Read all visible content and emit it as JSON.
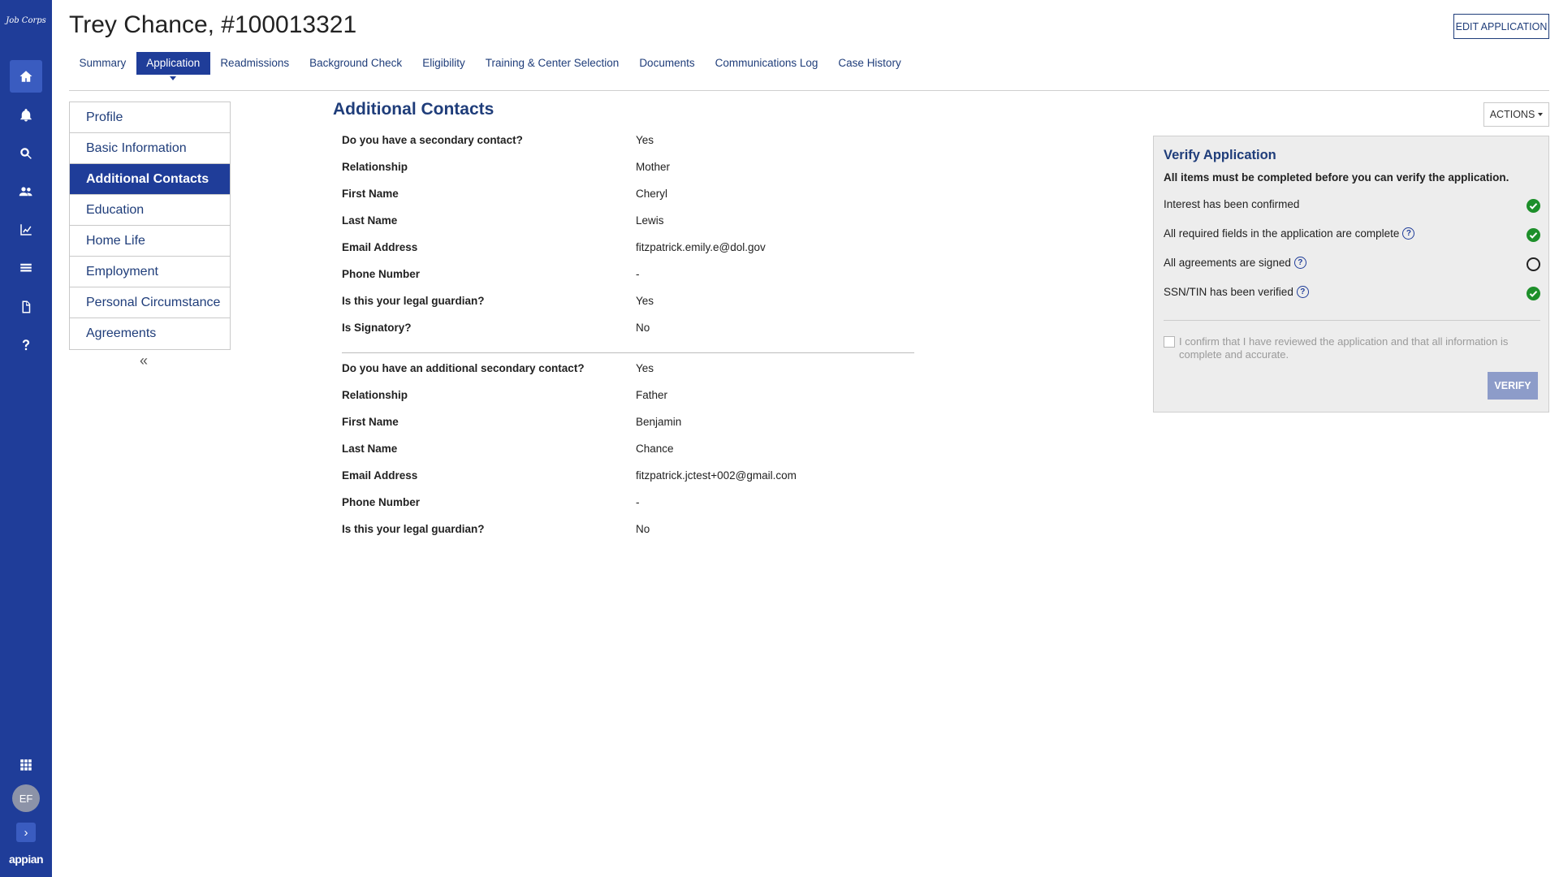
{
  "app": {
    "brand": "appian",
    "logo_text": "Job Corps",
    "user_initials": "EF"
  },
  "rail": {
    "icons": [
      "home-icon",
      "bell-icon",
      "search-icon",
      "users-icon",
      "chart-icon",
      "list-icon",
      "document-icon",
      "help-icon",
      "apps-grid-icon",
      "expand-icon"
    ],
    "expand_glyph": "›"
  },
  "header": {
    "title": "Trey Chance, #100013321",
    "edit_button": "EDIT APPLICATION"
  },
  "tabs": [
    {
      "label": "Summary",
      "active": false
    },
    {
      "label": "Application",
      "active": true
    },
    {
      "label": "Readmissions",
      "active": false
    },
    {
      "label": "Background Check",
      "active": false
    },
    {
      "label": "Eligibility",
      "active": false
    },
    {
      "label": "Training & Center Selection",
      "active": false
    },
    {
      "label": "Documents",
      "active": false
    },
    {
      "label": "Communications Log",
      "active": false
    },
    {
      "label": "Case History",
      "active": false
    }
  ],
  "side_menu": {
    "items": [
      {
        "label": "Profile",
        "active": false
      },
      {
        "label": "Basic Information",
        "active": false
      },
      {
        "label": "Additional Contacts",
        "active": true
      },
      {
        "label": "Education",
        "active": false
      },
      {
        "label": "Home Life",
        "active": false
      },
      {
        "label": "Employment",
        "active": false
      },
      {
        "label": "Personal Circumstance",
        "active": false
      },
      {
        "label": "Agreements",
        "active": false
      }
    ],
    "collapse_glyph": "«"
  },
  "main": {
    "section_title": "Additional Contacts",
    "contact1": [
      {
        "label": "Do you have a secondary contact?",
        "value": "Yes"
      },
      {
        "label": "Relationship",
        "value": "Mother"
      },
      {
        "label": "First Name",
        "value": "Cheryl"
      },
      {
        "label": "Last Name",
        "value": "Lewis"
      },
      {
        "label": "Email Address",
        "value": "fitzpatrick.emily.e@dol.gov"
      },
      {
        "label": "Phone Number",
        "value": "-"
      },
      {
        "label": "Is this your legal guardian?",
        "value": "Yes"
      },
      {
        "label": "Is Signatory?",
        "value": "No"
      }
    ],
    "contact2": [
      {
        "label": "Do you have an additional secondary contact?",
        "value": "Yes"
      },
      {
        "label": "Relationship",
        "value": "Father"
      },
      {
        "label": "First Name",
        "value": "Benjamin"
      },
      {
        "label": "Last Name",
        "value": "Chance"
      },
      {
        "label": "Email Address",
        "value": "fitzpatrick.jctest+002@gmail.com"
      },
      {
        "label": "Phone Number",
        "value": "-"
      },
      {
        "label": "Is this your legal guardian?",
        "value": "No"
      }
    ]
  },
  "actions": {
    "label": "ACTIONS"
  },
  "verify": {
    "title": "Verify Application",
    "instruction": "All items must be completed before you can verify the application.",
    "items": [
      {
        "label": "Interest has been confirmed",
        "has_help": false,
        "complete": true
      },
      {
        "label": "All required fields in the application are complete",
        "has_help": true,
        "complete": true
      },
      {
        "label": "All agreements are signed",
        "has_help": true,
        "complete": false
      },
      {
        "label": "SSN/TIN has been verified",
        "has_help": true,
        "complete": true
      }
    ],
    "confirm_text": "I confirm that I have reviewed the application and that all information is complete and accurate.",
    "button": "VERIFY",
    "help_glyph": "?"
  },
  "colors": {
    "primary": "#1f3d99",
    "link": "#1f3d7a",
    "success": "#1d8f2a",
    "panel_bg": "#ededed"
  }
}
